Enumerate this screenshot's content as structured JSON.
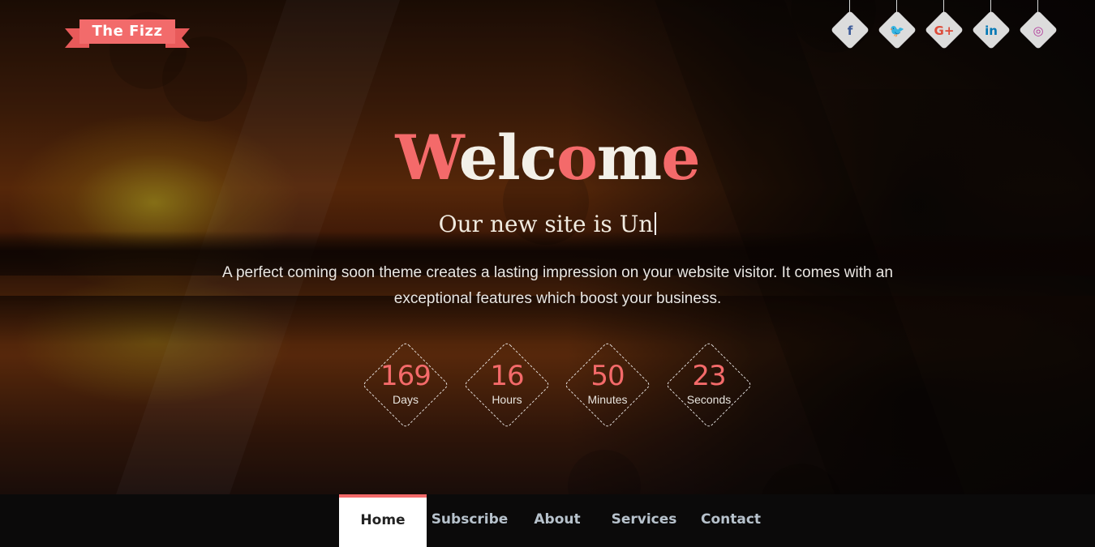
{
  "brand": {
    "logo_text": "The Fizz",
    "accent_color": "#f46a6a"
  },
  "social": [
    {
      "icon": "facebook-icon",
      "glyph": "f",
      "color": "#3b5998"
    },
    {
      "icon": "twitter-icon",
      "glyph": "🐦",
      "color": "#1da1f2"
    },
    {
      "icon": "google-plus-icon",
      "glyph": "G+",
      "color": "#dd4b39"
    },
    {
      "icon": "linkedin-icon",
      "glyph": "in",
      "color": "#0077b5"
    },
    {
      "icon": "instagram-icon",
      "glyph": "◎",
      "color": "#b13a9b"
    }
  ],
  "hero": {
    "title": {
      "part1": "W",
      "part2": "elc",
      "part3": "o",
      "part4": "m",
      "part5": "e"
    },
    "tagline": "Our new site is Un",
    "description": "A perfect coming soon theme creates a lasting impression on your website visitor. It comes with an exceptional features which boost your business."
  },
  "countdown": [
    {
      "value": "169",
      "label": "Days"
    },
    {
      "value": "16",
      "label": "Hours"
    },
    {
      "value": "50",
      "label": "Minutes"
    },
    {
      "value": "23",
      "label": "Seconds"
    }
  ],
  "nav": {
    "items": [
      {
        "label": "Home",
        "active": true
      },
      {
        "label": "Subscribe",
        "active": false
      },
      {
        "label": "About",
        "active": false
      },
      {
        "label": "Services",
        "active": false
      },
      {
        "label": "Contact",
        "active": false
      }
    ]
  }
}
